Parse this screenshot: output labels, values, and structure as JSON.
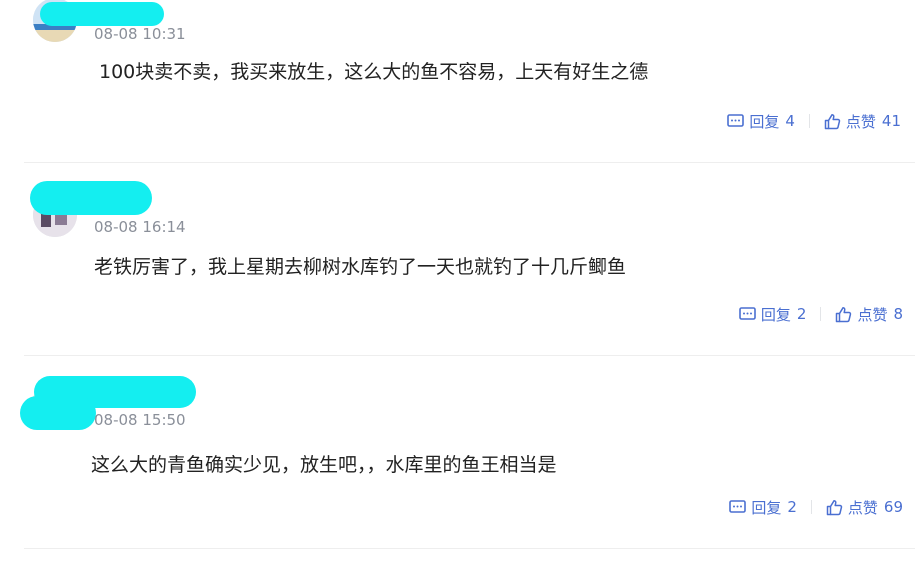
{
  "comments": [
    {
      "time": "08-08 10:31",
      "text": "100块卖不卖，我买来放生，这么大的鱼不容易，上天有好生之德",
      "reply_label": "回复",
      "reply_count": "4",
      "like_label": "点赞",
      "like_count": "41"
    },
    {
      "time": "08-08 16:14",
      "text": "老铁厉害了，我上星期去柳树水库钓了一天也就钓了十几斤鲫鱼",
      "reply_label": "回复",
      "reply_count": "2",
      "like_label": "点赞",
      "like_count": "8"
    },
    {
      "time": "08-08 15:50",
      "text": "这么大的青鱼确实少见，放生吧，，水库里的鱼王相当是",
      "reply_label": "回复",
      "reply_count": "2",
      "like_label": "点赞",
      "like_count": "69"
    }
  ],
  "colors": {
    "accent": "#4a6fd1",
    "redaction": "#14eef0",
    "text": "#222222",
    "meta": "#8a8f99"
  },
  "icons": {
    "reply": "comment-box-icon",
    "like": "thumbs-up-icon"
  }
}
